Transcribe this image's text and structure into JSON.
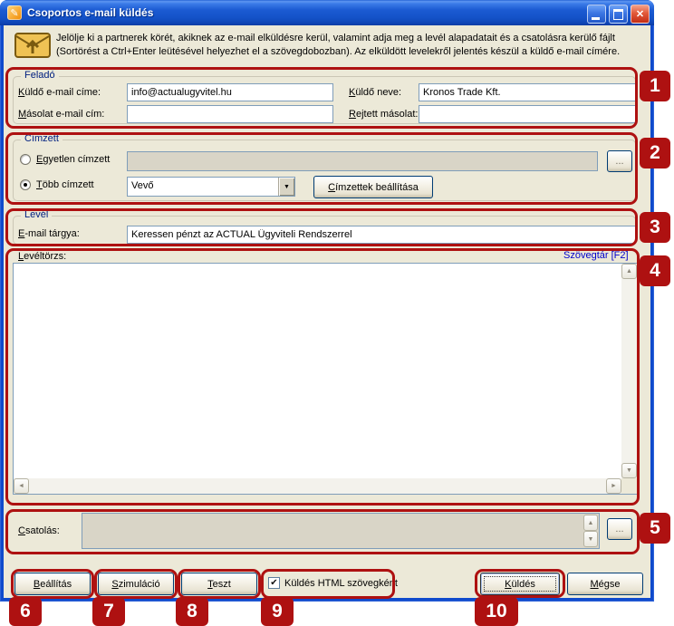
{
  "window": {
    "title": "Csoportos e-mail küldés"
  },
  "header": {
    "line1": "Jelölje ki a partnerek körét, akiknek az e-mail elküldésre kerül, valamint adja meg a levél alapadatait és a csatolásra kerülő fájlt",
    "line2": "(Sortörést a Ctrl+Enter leütésével helyezhet el a szövegdobozban). Az elküldött levelekről jelentés készül a küldő e-mail címére."
  },
  "felado": {
    "title": "Feladó",
    "kuldo_email_label": "Küldő e-mail címe:",
    "kuldo_email_value": "info@actualugyvitel.hu",
    "kuldo_neve_label": "Küldő neve:",
    "kuldo_neve_value": "Kronos Trade Kft.",
    "masolat_label": "Másolat e-mail cím:",
    "masolat_value": "",
    "rejtett_label": "Rejtett másolat:",
    "rejtett_value": ""
  },
  "cimzett": {
    "title": "Címzett",
    "egyetlen_label": "Egyetlen címzett",
    "egyetlen_value": "",
    "tobb_label": "Több címzett",
    "tipus_value": "Vevő",
    "cimzettek_button": "Címzettek beállítása",
    "browse_button": "..."
  },
  "level": {
    "title": "Levél",
    "targy_label": "E-mail tárgya:",
    "targy_value": "Keressen pénzt az ACTUAL Ügyviteli Rendszerrel"
  },
  "leveltorzs": {
    "label": "Levéltörzs:",
    "szovegtar_link": "Szövegtár [F2]",
    "value": ""
  },
  "csatolas": {
    "label": "Csatolás:",
    "value": "",
    "browse_button": "..."
  },
  "footer": {
    "beallitas": "Beállítás",
    "szimulacio": "Szimuláció",
    "teszt": "Teszt",
    "html_label": "Küldés HTML szövegként",
    "html_checked": true,
    "kuldes": "Küldés",
    "megse": "Mégse"
  },
  "glyphs": {
    "close": "✕",
    "pencil": "✎",
    "combo_arrow": "▼",
    "check": "✔",
    "up": "▲",
    "down": "▼",
    "left": "◄",
    "right": "►"
  },
  "callouts": {
    "n1": "1",
    "n2": "2",
    "n3": "3",
    "n4": "4",
    "n5": "5",
    "n6": "6",
    "n7": "7",
    "n8": "8",
    "n9": "9",
    "n10": "10"
  },
  "colors": {
    "annotation_red": "#AE1111",
    "titlebar_blue": "#0F4ACC",
    "dialog_beige": "#ECE9D8",
    "group_label_navy": "#002080",
    "link_blue": "#0000CC"
  }
}
